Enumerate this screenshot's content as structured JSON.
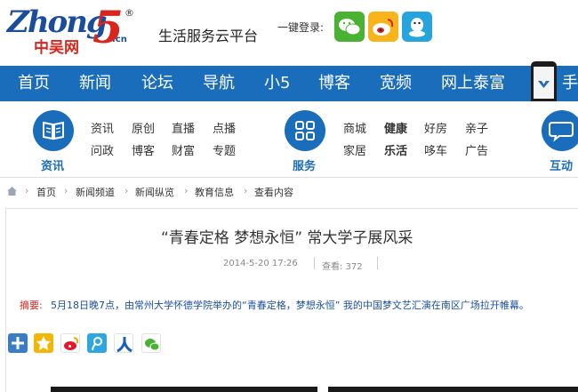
{
  "logo": {
    "wordmark": "Zhong",
    "number": "5",
    "reg": "®",
    "cn_name": "中吴网",
    "suffix": ".cn"
  },
  "slogan": "生活服务云平台",
  "login_label": "一键登录:",
  "social_login": [
    {
      "name": "wechat-icon",
      "color": "#49b233"
    },
    {
      "name": "weibo-icon",
      "color": "#f7b51b"
    },
    {
      "name": "qq-icon",
      "color": "#27a4dd"
    }
  ],
  "nav": {
    "items": [
      "首页",
      "新闻",
      "论坛",
      "导航",
      "小5",
      "博客",
      "宽频",
      "网上泰富",
      "手"
    ],
    "color": "#1a6dbb"
  },
  "categories": [
    {
      "title": "资讯",
      "icon": "book-icon",
      "links": [
        "资讯",
        "原创",
        "直播",
        "点播",
        "问政",
        "博客",
        "财富",
        "专题"
      ]
    },
    {
      "title": "服务",
      "icon": "grid-icon",
      "links": [
        "商城",
        "健康",
        "好房",
        "亲子",
        "家居",
        "乐活",
        "哆车",
        "广告"
      ]
    },
    {
      "title": "互动",
      "icon": "chat-bubble-icon",
      "links": []
    }
  ],
  "breadcrumb": [
    "首页",
    "新闻频道",
    "新闻纵览",
    "教育信息",
    "查看内容"
  ],
  "article": {
    "title": "“青春定格 梦想永恒” 常大学子展风采",
    "date": "2014-5-20 17:26",
    "views": "查看: 372",
    "summary_label": "摘要:",
    "summary": "5月18日晚7点，由常州大学怀德学院举办的“青春定格，梦想永恒” 我的中国梦文艺汇演在南区广场拉开帷幕。"
  },
  "share_icons": [
    "plus-icon",
    "qzone-icon",
    "weibo-icon",
    "tencent-weibo-icon",
    "renren-icon",
    "wechat-icon"
  ]
}
